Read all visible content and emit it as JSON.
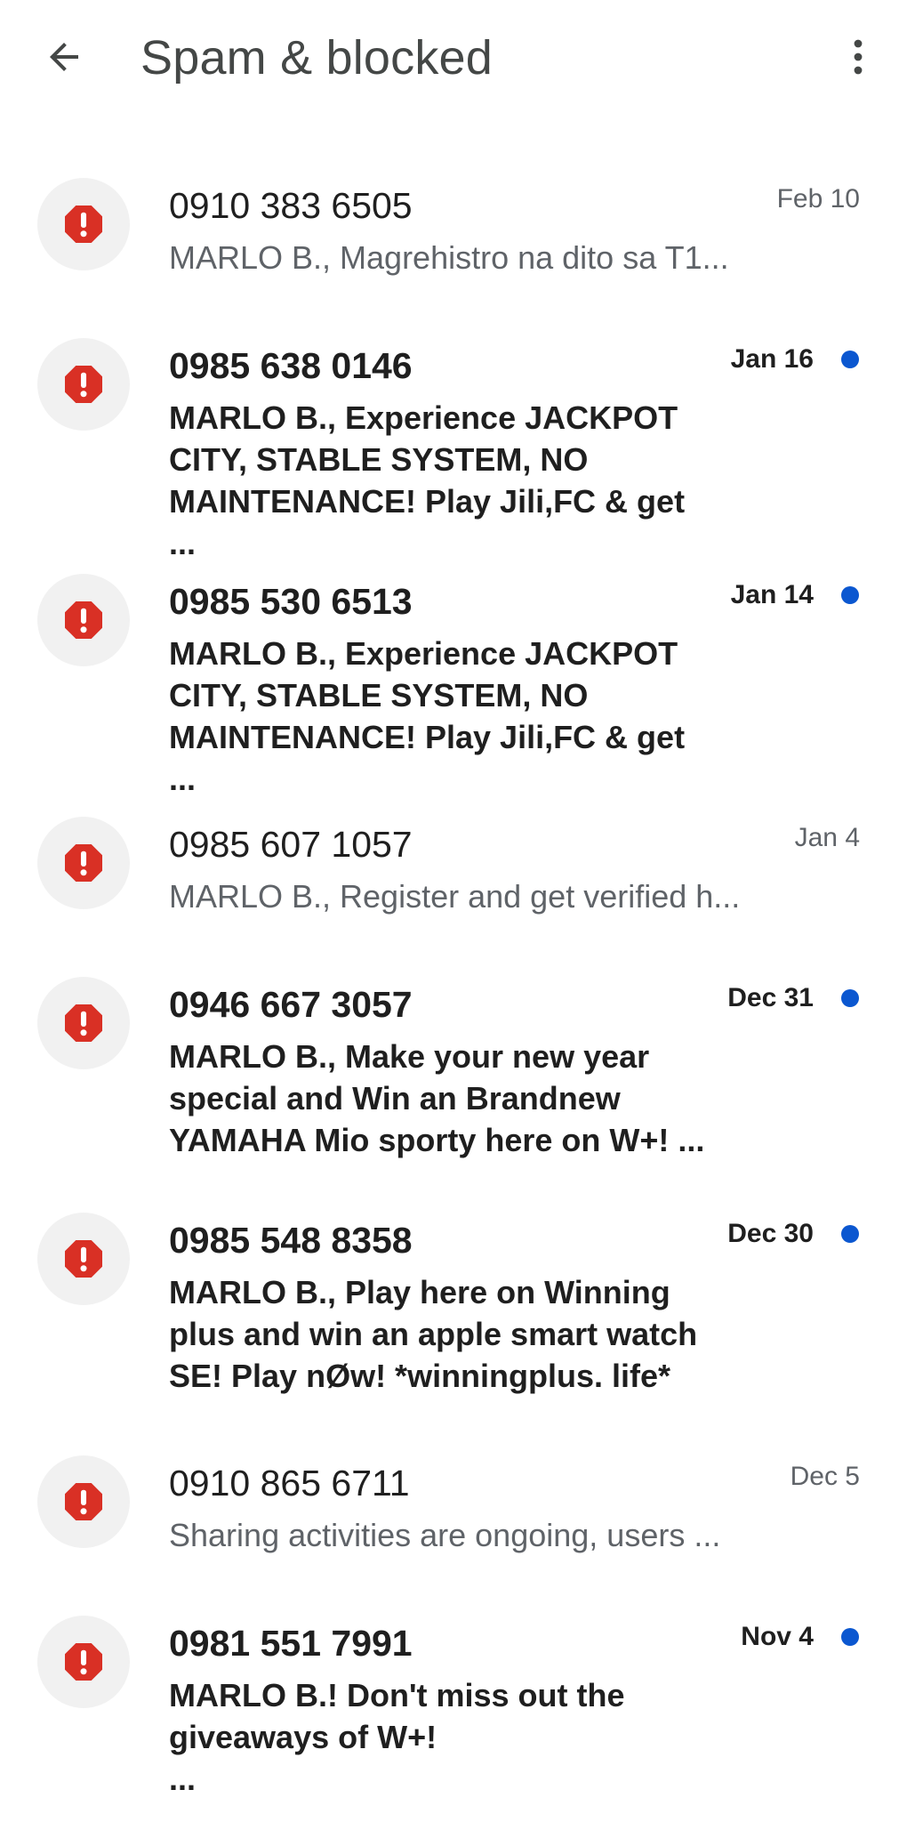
{
  "header": {
    "title": "Spam & blocked",
    "back_icon": "arrow-back-icon",
    "menu_icon": "more-vert-icon"
  },
  "colors": {
    "spam_icon": "#d93025",
    "unread_dot": "#0b57d0",
    "avatar_bg": "#f1f1f1"
  },
  "conversations": [
    {
      "sender": "0910 383 6505",
      "preview": "MARLO B., Magrehistro na dito sa T1...",
      "date": "Feb 10",
      "unread": false
    },
    {
      "sender": "0985 638 0146",
      "preview": "MARLO B., Experience JACKPOT CITY, STABLE SYSTEM, NO MAINTENANCE! Play Jili,FC & get ...",
      "date": "Jan 16",
      "unread": true
    },
    {
      "sender": "0985 530 6513",
      "preview": "MARLO B., Experience JACKPOT CITY, STABLE SYSTEM, NO MAINTENANCE! Play Jili,FC & get ...",
      "date": "Jan 14",
      "unread": true
    },
    {
      "sender": "0985 607 1057",
      "preview": "MARLO B., Register and get verified h...",
      "date": "Jan 4",
      "unread": false
    },
    {
      "sender": "0946 667 3057",
      "preview": "MARLO B., Make your new year special  and Win an Brandnew YAMAHA Mio sporty here on W+! ...",
      "date": "Dec 31",
      "unread": true
    },
    {
      "sender": "0985 548 8358",
      "preview": "MARLO B., Play here on Winning plus and win an apple smart watch SE! Play nØw! *winningplus. life*",
      "date": "Dec 30",
      "unread": true
    },
    {
      "sender": "0910 865 6711",
      "preview": "Sharing activities are ongoing, users ...",
      "date": "Dec 5",
      "unread": false
    },
    {
      "sender": "0981 551 7991",
      "preview": "MARLO B.! Don't miss out the giveaways of W+!\n...",
      "date": "Nov 4",
      "unread": true
    }
  ]
}
